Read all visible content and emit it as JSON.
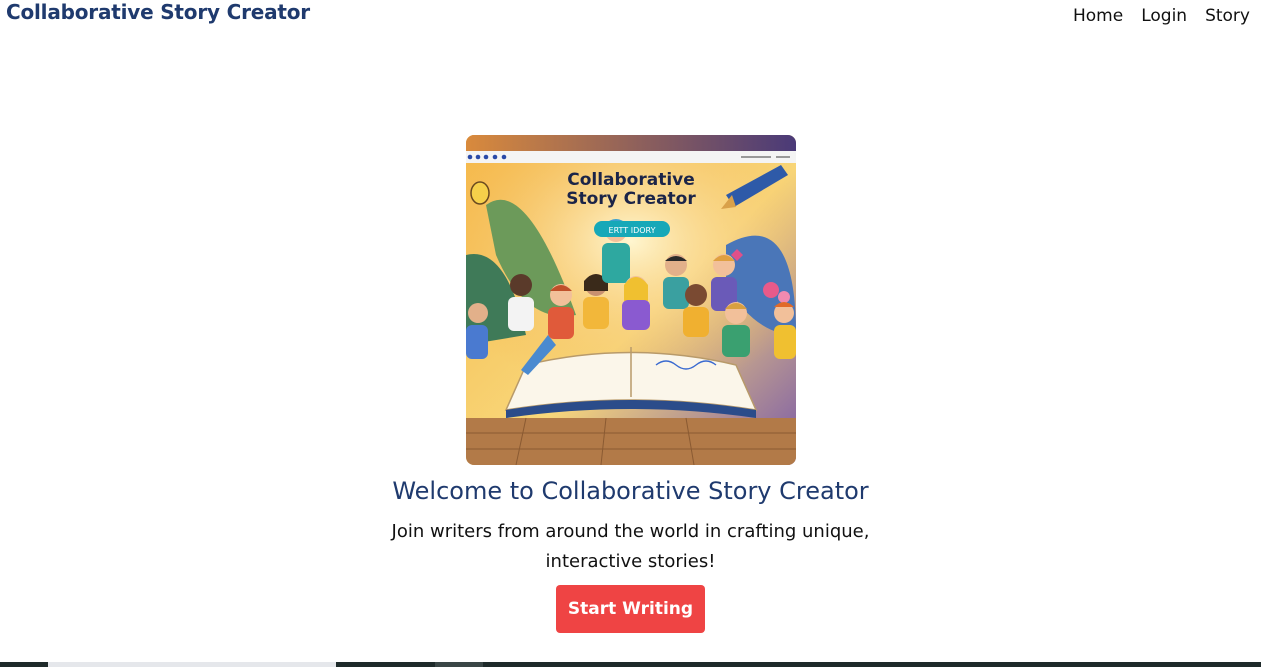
{
  "header": {
    "brand": "Collaborative Story Creator",
    "nav": [
      "Home",
      "Login",
      "Story"
    ]
  },
  "hero": {
    "image": {
      "heading_line1": "Collaborative",
      "heading_line2": "Story Creator",
      "pill_label": "ERTT IDORY"
    },
    "title": "Welcome to Collaborative Story Creator",
    "subtitle": "Join writers from around the world in crafting unique, interactive stories!",
    "cta_label": "Start Writing"
  },
  "colors": {
    "brand": "#1f3a6e",
    "cta": "#ef4444"
  }
}
